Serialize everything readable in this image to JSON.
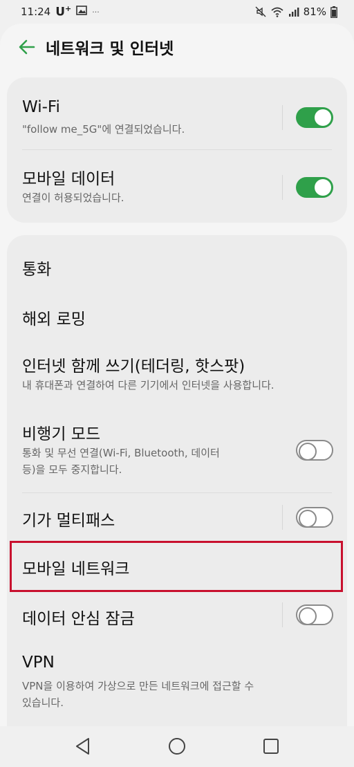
{
  "status_bar": {
    "time": "11:24",
    "carrier": "U",
    "carrier_sup": "+",
    "extra": "···",
    "battery_percent": "81%"
  },
  "header": {
    "title": "네트워크 및 인터넷"
  },
  "connectivity": {
    "wifi": {
      "title": "Wi-Fi",
      "subtitle": "\"follow me_5G\"에 연결되었습니다.",
      "enabled": true
    },
    "mobile_data": {
      "title": "모바일 데이터",
      "subtitle": "연결이 허용되었습니다.",
      "enabled": true
    }
  },
  "settings": {
    "calls": {
      "title": "통화"
    },
    "roaming": {
      "title": "해외 로밍"
    },
    "tethering": {
      "title": "인터넷 함께 쓰기(테더링, 핫스팟)",
      "subtitle": "내 휴대폰과 연결하여 다른 기기에서 인터넷을 사용합니다."
    },
    "airplane": {
      "title": "비행기 모드",
      "subtitle_line1": "통화 및 무선 연결(Wi-Fi, Bluetooth, 데이터",
      "subtitle_line2": "등)을 모두 중지합니다.",
      "enabled": false
    },
    "giga_multipath": {
      "title": "기가 멀티패스",
      "enabled": false
    },
    "mobile_network": {
      "title": "모바일 네트워크"
    },
    "data_lock": {
      "title": "데이터 안심 잠금",
      "enabled": false
    },
    "vpn": {
      "title": "VPN",
      "subtitle_line1": "VPN을 이용하여 가상으로 만든 네트워크에 접근할 수",
      "subtitle_line2": "있습니다."
    }
  },
  "colors": {
    "accent": "#2fa04a",
    "highlight": "#c8102e"
  },
  "icons": {
    "back": "arrow-left-icon",
    "nav_back": "triangle-back-icon",
    "nav_home": "circle-home-icon",
    "nav_recent": "square-recent-icon"
  }
}
